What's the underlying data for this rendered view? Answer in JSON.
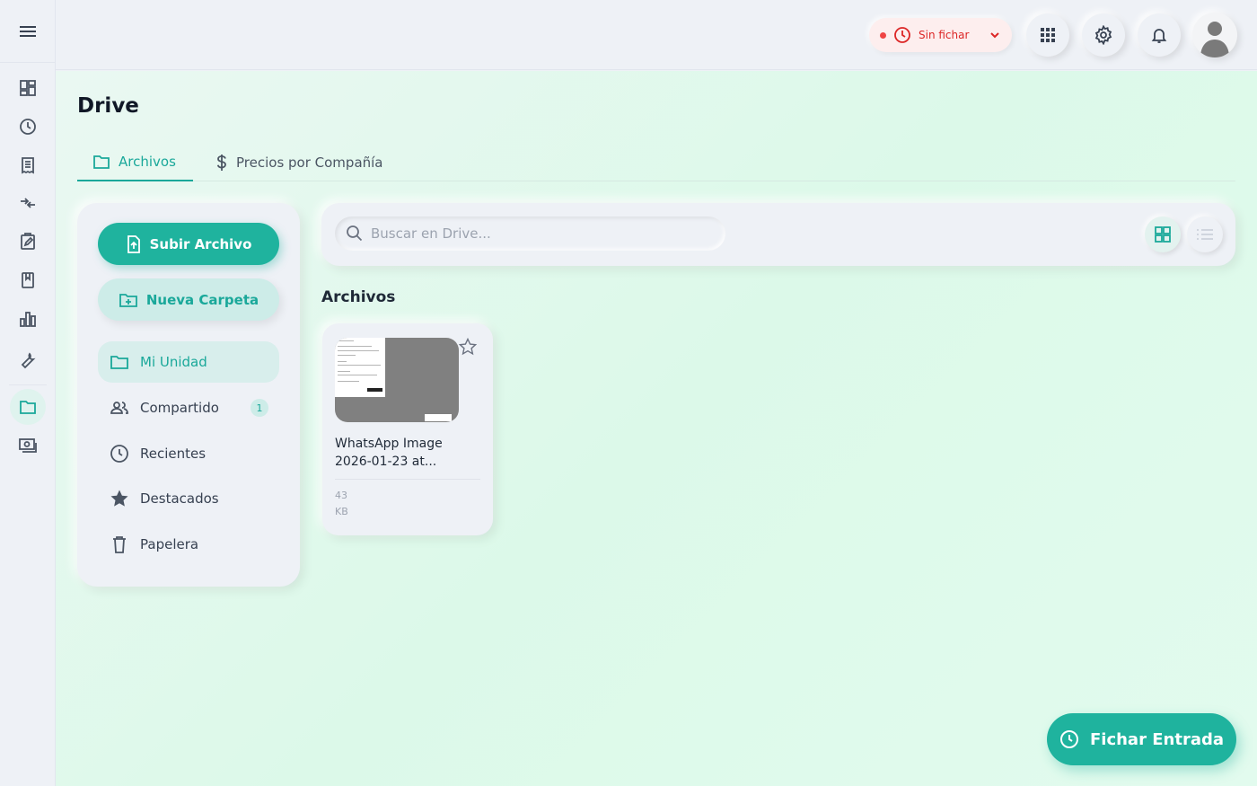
{
  "topbar": {
    "status_label": "Sin fichar",
    "status_color": "#dc2626"
  },
  "main": {
    "title": "Drive",
    "tabs": [
      {
        "label": "Archivos",
        "icon": "folder-icon",
        "active": true
      },
      {
        "label": "Precios por Compañía",
        "icon": "dollar-icon",
        "active": false
      }
    ]
  },
  "sidebar": {
    "upload_label": "Subir Archivo",
    "new_folder_label": "Nueva Carpeta",
    "items": [
      {
        "label": "Mi Unidad",
        "icon": "folder-icon",
        "active": true
      },
      {
        "label": "Compartido",
        "icon": "people-icon",
        "badge": "1"
      },
      {
        "label": "Recientes",
        "icon": "clock-icon"
      },
      {
        "label": "Destacados",
        "icon": "star-icon"
      },
      {
        "label": "Papelera",
        "icon": "trash-icon"
      }
    ]
  },
  "search": {
    "placeholder": "Buscar en Drive..."
  },
  "files_section": {
    "title": "Archivos",
    "files": [
      {
        "name": "WhatsApp Image 2026-01-23 at...",
        "size": "43 KB"
      }
    ]
  },
  "fab": {
    "label": "Fichar Entrada"
  },
  "colors": {
    "accent": "#1fb39e",
    "danger": "#dc2626"
  }
}
